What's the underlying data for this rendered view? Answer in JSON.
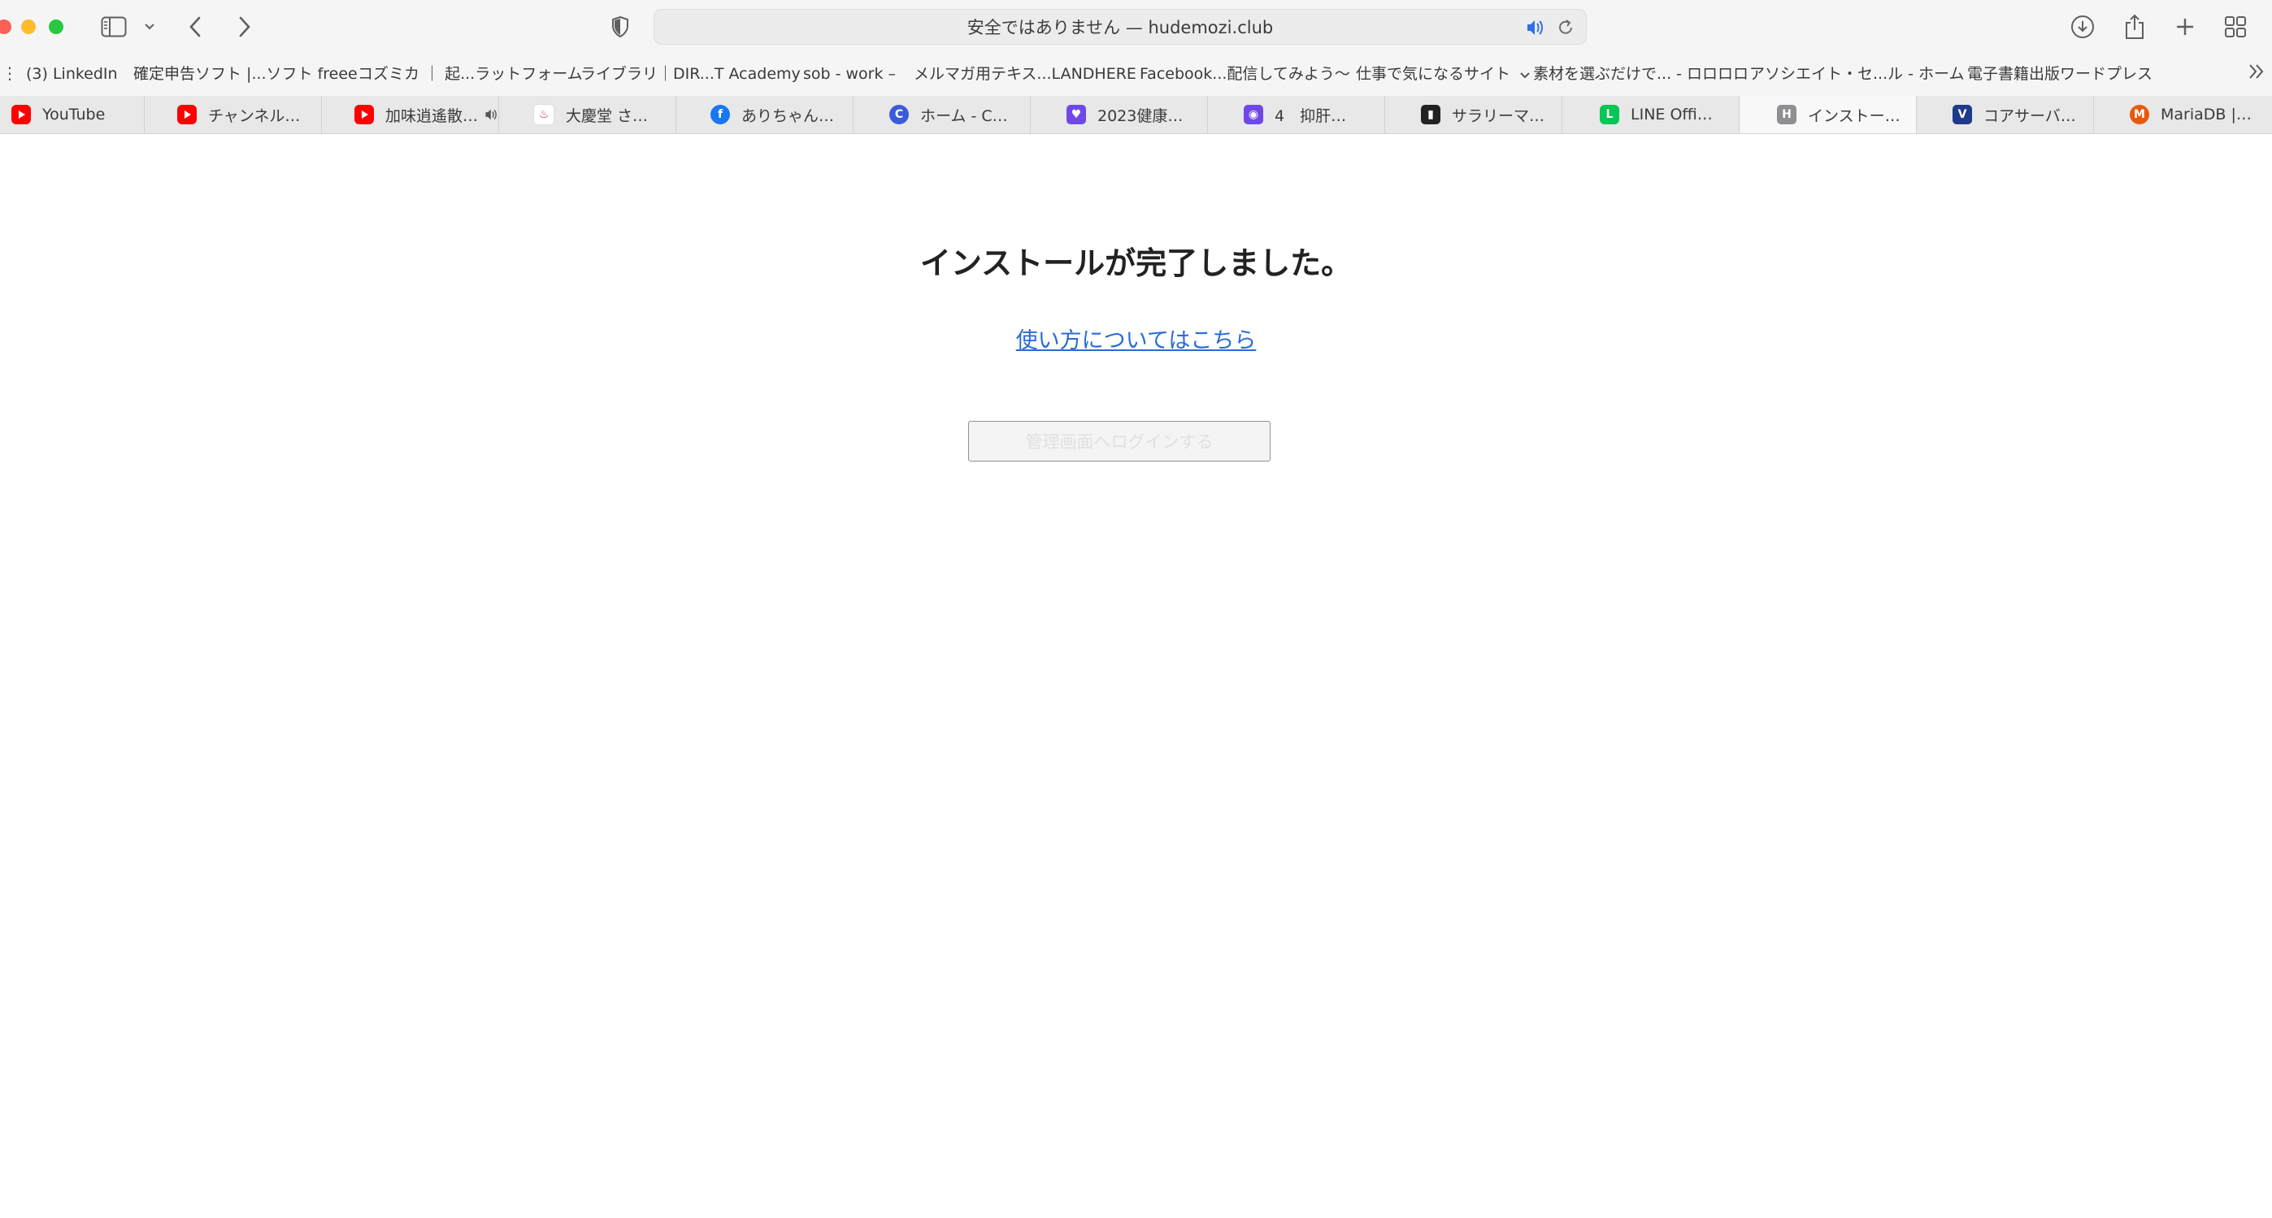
{
  "browser": {
    "address_text": "安全ではありません — hudemozi.club"
  },
  "bookmarks": [
    "(3) LinkedIn",
    "確定申告ソフト |...ソフト freee",
    "コズミカ ｜ 起...ラットフォーム",
    "ライブラリ｜DIR...T Academy",
    "sob - work –",
    "メルマガ用テキス...LANDHERE",
    "Facebook...配信してみよう〜",
    "仕事で気になるサイト",
    "素材を選ぶだけで... - ロロロロ",
    "アソシエイト・セ...ル - ホーム",
    "電子書籍出版ワードプレス"
  ],
  "tabs": [
    {
      "title": "YouTube",
      "icon": "youtube-icon"
    },
    {
      "title": "チャンネル…",
      "icon": "youtube-icon"
    },
    {
      "title": "加味逍遙散…",
      "icon": "youtube-icon"
    },
    {
      "title": "大慶堂 さ…",
      "icon": "daikeido-icon"
    },
    {
      "title": "ありちゃん…",
      "icon": "facebook-icon"
    },
    {
      "title": "ホーム - C…",
      "icon": "c-icon"
    },
    {
      "title": "2023健康…",
      "icon": "chat-icon"
    },
    {
      "title": "4　抑肝…",
      "icon": "podcast-icon"
    },
    {
      "title": "サラリーマ…",
      "icon": "chart-icon"
    },
    {
      "title": "LINE Offi…",
      "icon": "line-icon"
    },
    {
      "title": "インストー…",
      "icon": "h-icon"
    },
    {
      "title": "コアサーバ…",
      "icon": "v-icon"
    },
    {
      "title": "MariaDB |…",
      "icon": "mariadb-icon"
    }
  ],
  "page": {
    "heading": "インストールが完了しました。",
    "help_link": "使い方についてはこちら",
    "login_button": "管理画面へログインする"
  },
  "colors": {
    "link": "#2a6bd6",
    "toolbar_bg": "#f5f5f5",
    "tabbar_bg": "#e8e8e8"
  }
}
